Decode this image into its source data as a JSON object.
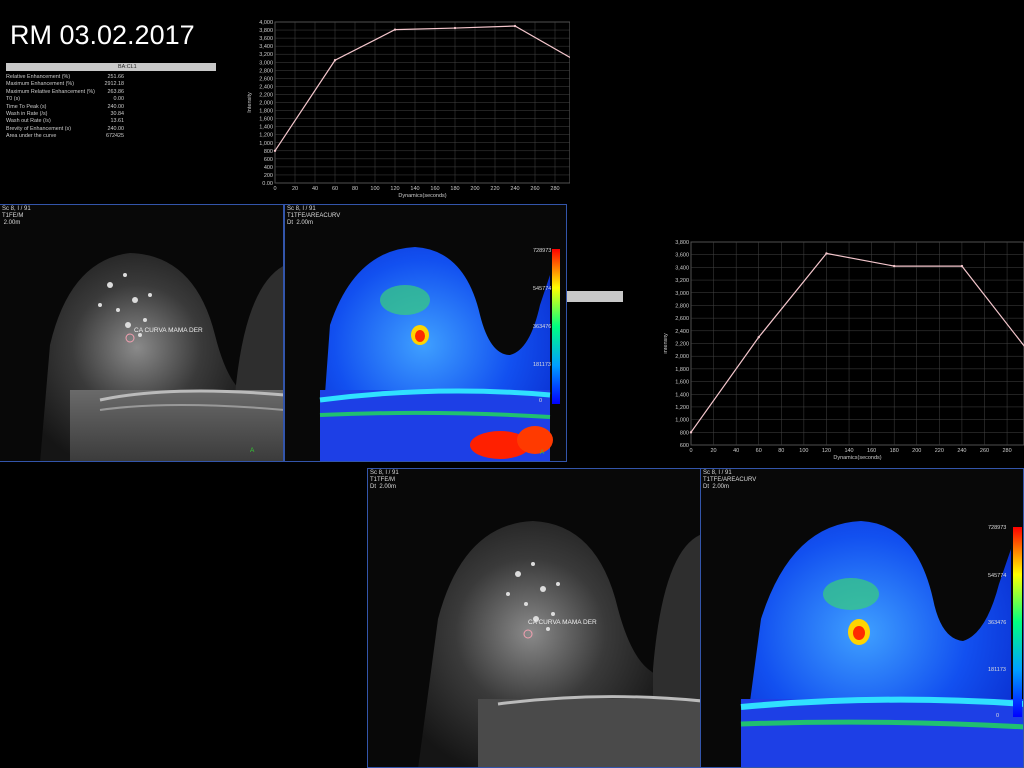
{
  "slide": {
    "title": "RM 03.02.2017"
  },
  "stats_table": {
    "column_header": "BA:CL1",
    "rows": [
      {
        "label": "Relative Enhancement (%)",
        "value": "251.66"
      },
      {
        "label": "Maximum Enhancement (%)",
        "value": "2912.18"
      },
      {
        "label": "Maximum Relative Enhancement (%)",
        "value": "263.86"
      },
      {
        "label": "T0 (s)",
        "value": "0.00"
      },
      {
        "label": "Time To Peak (s)",
        "value": "240.00"
      },
      {
        "label": "Wash in Rate (/s)",
        "value": "30.84"
      },
      {
        "label": "Wash out Rate (/s)",
        "value": "13.61"
      },
      {
        "label": "Brevity of Enhancement (s)",
        "value": "240.00"
      },
      {
        "label": "Area under the curve",
        "value": "672425"
      }
    ]
  },
  "chart_data": [
    {
      "type": "line",
      "xlabel": "Dynamics(seconds)",
      "ylabel": "Intensity",
      "xlim": [
        0,
        295
      ],
      "ylim": [
        0,
        4000
      ],
      "x_ticks": [
        "0",
        "20",
        "40",
        "60",
        "80",
        "100",
        "120",
        "140",
        "160",
        "180",
        "200",
        "220",
        "240",
        "260",
        "280"
      ],
      "y_ticks": [
        "0.00",
        "200",
        "400",
        "600",
        "800",
        "1,000",
        "1,200",
        "1,400",
        "1,600",
        "1,800",
        "2,000",
        "2,200",
        "2,400",
        "2,600",
        "2,800",
        "3,000",
        "3,200",
        "3,400",
        "3,600",
        "3,800",
        "4,000"
      ],
      "grid": true,
      "series": [
        {
          "x": [
            0,
            60,
            120,
            180,
            240,
            300
          ],
          "y": [
            800,
            3050,
            3810,
            3850,
            3900,
            3050
          ]
        }
      ]
    },
    {
      "type": "line",
      "xlabel": "Dynamics(seconds)",
      "ylabel": "Intensity",
      "xlim": [
        0,
        295
      ],
      "ylim": [
        600,
        3800
      ],
      "x_ticks": [
        "0",
        "20",
        "40",
        "60",
        "80",
        "100",
        "120",
        "140",
        "160",
        "180",
        "200",
        "220",
        "240",
        "260",
        "280"
      ],
      "y_ticks": [
        "600",
        "800",
        "1,000",
        "1,200",
        "1,400",
        "1,600",
        "1,800",
        "2,000",
        "2,200",
        "2,400",
        "2,600",
        "2,800",
        "3,000",
        "3,200",
        "3,400",
        "3,600",
        "3,800"
      ],
      "grid": true,
      "series": [
        {
          "x": [
            0,
            60,
            120,
            180,
            240,
            300
          ],
          "y": [
            800,
            2300,
            3620,
            3420,
            3420,
            2050
          ]
        }
      ]
    }
  ],
  "panels": {
    "mri_top_left": {
      "header": "Sc 8, I / 91\nT1FE/M\n 2.00m",
      "roi_label": "CA CURVA MAMA DER",
      "corner_label": "A"
    },
    "color_top": {
      "header": "Sc 8, I / 91\nT1TFE/AREACURV\nDt  2.00m",
      "corner_label": "A",
      "colorbar": [
        "728973",
        "545774",
        "363476",
        "181173",
        "0"
      ]
    },
    "mri_bottom": {
      "header": "Sc 8, I / 91\nT1TFE/M\nDt  2.00m",
      "roi_label": "CA CURVA MAMA DER"
    },
    "color_bottom": {
      "header": "Sc 8, I / 91\nT1TFE/AREACURV\nDt  2.00m",
      "colorbar": [
        "728973",
        "545774",
        "363476",
        "181173",
        "0"
      ]
    }
  },
  "colors": {
    "curve": "#f4c6cc",
    "panel_border": "#3355aa",
    "grid": "#444444"
  }
}
